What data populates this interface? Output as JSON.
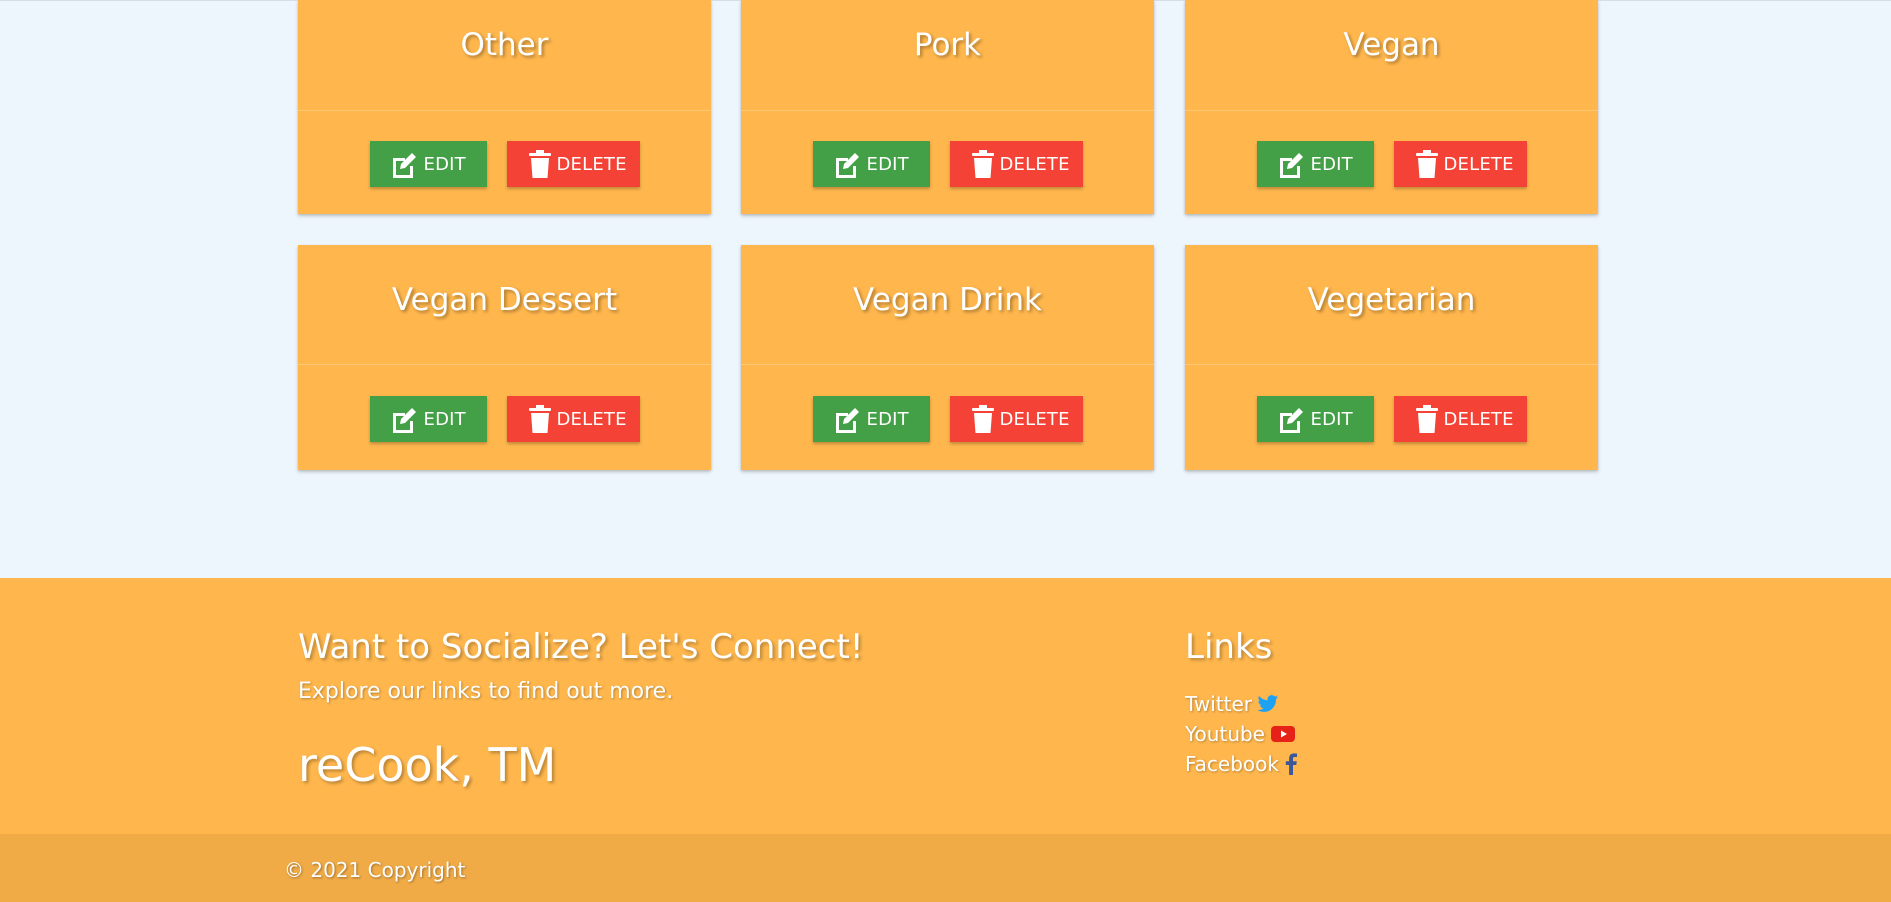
{
  "categories": [
    {
      "name": "Other",
      "edit_label": "EDIT",
      "delete_label": "DELETE"
    },
    {
      "name": "Pork",
      "edit_label": "EDIT",
      "delete_label": "DELETE"
    },
    {
      "name": "Vegan",
      "edit_label": "EDIT",
      "delete_label": "DELETE"
    },
    {
      "name": "Vegan Dessert",
      "edit_label": "EDIT",
      "delete_label": "DELETE"
    },
    {
      "name": "Vegan Drink",
      "edit_label": "EDIT",
      "delete_label": "DELETE"
    },
    {
      "name": "Vegetarian",
      "edit_label": "EDIT",
      "delete_label": "DELETE"
    }
  ],
  "icons": {
    "edit": "edit-icon",
    "delete": "trash-icon"
  },
  "footer": {
    "heading": "Want to Socialize? Let's Connect!",
    "subtext": "Explore our links to find out more.",
    "brand": "reCook, TM",
    "links_heading": "Links",
    "links": [
      {
        "label": "Twitter",
        "icon": "twitter-icon"
      },
      {
        "label": "Youtube",
        "icon": "youtube-icon"
      },
      {
        "label": "Facebook",
        "icon": "facebook-icon"
      }
    ],
    "copyright": "© 2021 Copyright"
  },
  "colors": {
    "card_background": "#ffb74d",
    "edit_button": "#43a047",
    "delete_button": "#f44336",
    "page_background": "#eef6fd",
    "copyright_bar": "#f0ab47"
  }
}
